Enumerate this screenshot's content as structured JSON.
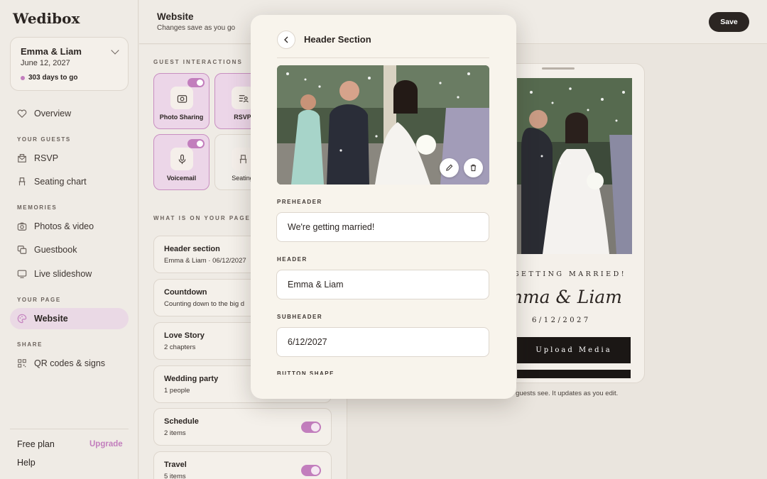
{
  "brand": {
    "logo": "Wedibox"
  },
  "couple": {
    "name": "Emma & Liam",
    "date": "June 12, 2027",
    "countdown": "303 days to go"
  },
  "sidebar": {
    "overview": "Overview",
    "sections": {
      "guests": "YOUR GUESTS",
      "memories": "MEMORIES",
      "page": "YOUR PAGE",
      "share": "SHARE"
    },
    "items": [
      {
        "label": "RSVP",
        "icon": "rsvp-icon"
      },
      {
        "label": "Seating chart",
        "icon": "seating-icon"
      },
      {
        "label": "Photos & video",
        "icon": "camera-icon"
      },
      {
        "label": "Guestbook",
        "icon": "guestbook-icon"
      },
      {
        "label": "Live slideshow",
        "icon": "slideshow-icon"
      },
      {
        "label": "Website",
        "icon": "palette-icon",
        "active": true
      },
      {
        "label": "QR codes & signs",
        "icon": "qr-icon"
      }
    ],
    "plan": "Free plan",
    "upgrade": "Upgrade",
    "help": "Help"
  },
  "topbar": {
    "title": "Website",
    "subtitle": "Changes save as you go",
    "save": "Save"
  },
  "guest_interactions": {
    "heading": "GUEST INTERACTIONS",
    "features": [
      {
        "label": "Photo Sharing",
        "enabled": true
      },
      {
        "label": "RSVP",
        "enabled": true
      },
      {
        "label": "Voicemail",
        "enabled": true
      },
      {
        "label": "Seating",
        "enabled": false
      }
    ]
  },
  "page_contents": {
    "heading": "WHAT IS ON YOUR PAGE",
    "cards": [
      {
        "title": "Header section",
        "subtitle": "Emma & Liam · 06/12/2027"
      },
      {
        "title": "Countdown",
        "subtitle": "Counting down to the big d"
      },
      {
        "title": "Love Story",
        "subtitle": "2 chapters"
      },
      {
        "title": "Wedding party",
        "subtitle": "1 people"
      },
      {
        "title": "Schedule",
        "subtitle": "2 items",
        "enabled": true
      },
      {
        "title": "Travel",
        "subtitle": "5 items",
        "enabled": true
      }
    ]
  },
  "modal": {
    "title": "Header Section",
    "fields": {
      "preheader_label": "PREHEADER",
      "preheader_value": "We're getting married!",
      "header_label": "HEADER",
      "header_value": "Emma & Liam",
      "subheader_label": "SUBHEADER",
      "subheader_value": "6/12/2027",
      "next_label": "BUTTON SHAPE"
    }
  },
  "preview": {
    "preheader": "E GETTING MARRIED!",
    "header": "Emma & Liam",
    "subheader": "6/12/2027",
    "button": "Upload Media",
    "note": "ur guests see. It updates as you edit."
  },
  "colors": {
    "accent": "#c27ebd",
    "dark": "#2b2522",
    "background": "#eae5de"
  }
}
